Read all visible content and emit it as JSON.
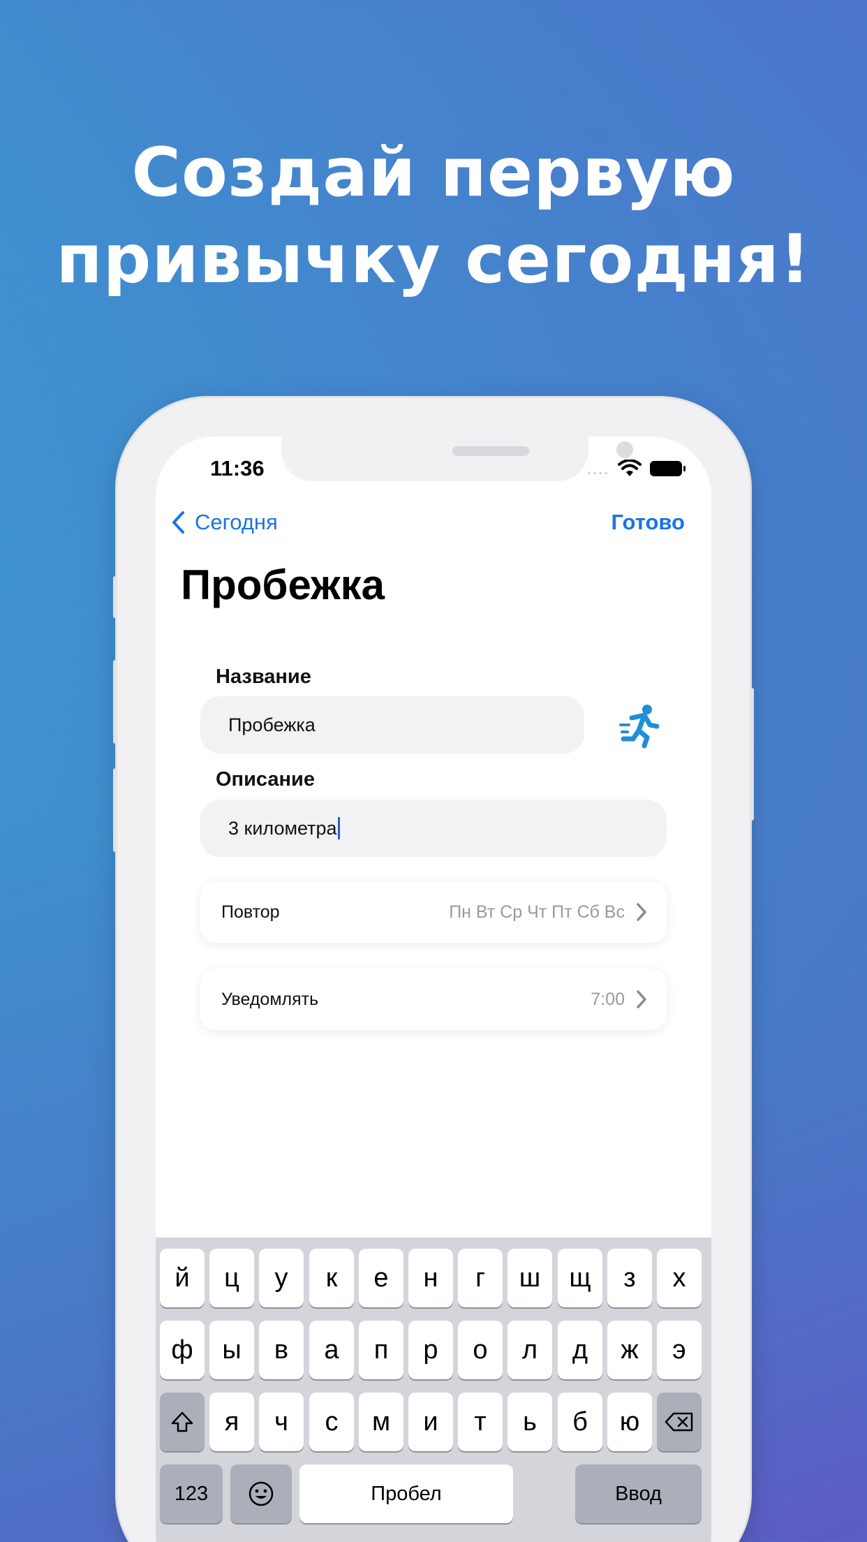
{
  "headline": {
    "line1": "Создай первую",
    "line2": "привычку сегодня!"
  },
  "status_bar": {
    "time": "11:36",
    "dots": "....",
    "icons": [
      "wifi-icon",
      "battery-icon"
    ]
  },
  "nav": {
    "back_label": "Сегодня",
    "done_label": "Готово"
  },
  "page_title": "Пробежка",
  "form": {
    "name_label": "Название",
    "name_value": "Пробежка",
    "habit_icon": "running-person-icon",
    "description_label": "Описание",
    "description_value": "3 километра"
  },
  "rows": [
    {
      "label": "Повтор",
      "value": "Пн Вт Ср Чт Пт Сб Вс"
    },
    {
      "label": "Уведомлять",
      "value": "7:00"
    }
  ],
  "keyboard": {
    "row1": [
      "й",
      "ц",
      "у",
      "к",
      "е",
      "н",
      "г",
      "ш",
      "щ",
      "з",
      "х"
    ],
    "row2": [
      "ф",
      "ы",
      "в",
      "а",
      "п",
      "р",
      "о",
      "л",
      "д",
      "ж",
      "э"
    ],
    "row3": [
      "я",
      "ч",
      "с",
      "м",
      "и",
      "т",
      "ь",
      "б",
      "ю"
    ],
    "numbers_key": "123",
    "space_key": "Пробел",
    "return_key": "Ввод"
  },
  "colors": {
    "accent": "#1a73e8",
    "icon": "#1f8fd8",
    "cursor": "#2b5bdc"
  }
}
